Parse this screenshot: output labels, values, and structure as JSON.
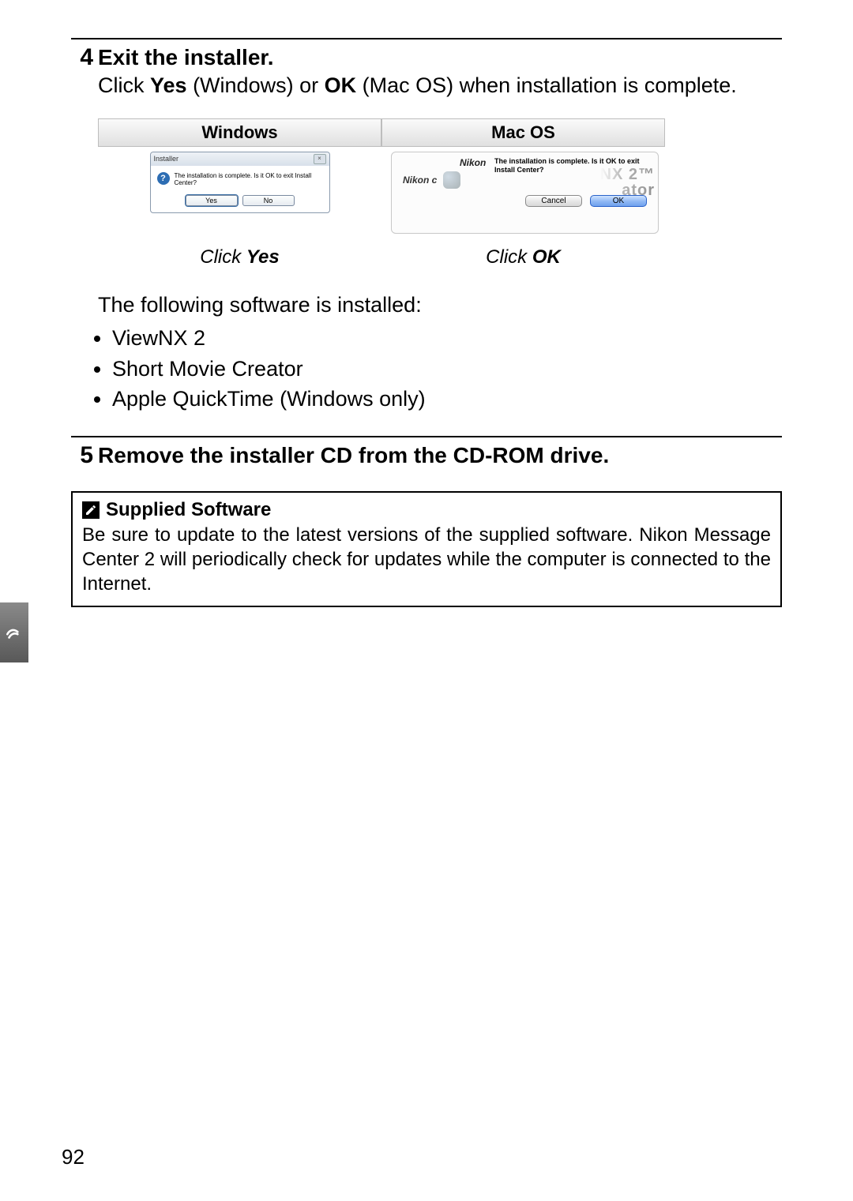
{
  "step4": {
    "number": "4",
    "title": "Exit the installer.",
    "desc_prefix": "Click ",
    "desc_yes": "Yes",
    "desc_mid1": " (Windows) or ",
    "desc_ok": "OK",
    "desc_mid2": " (Mac OS) when installation is com",
    "desc_suffix": "plete."
  },
  "os_headers": {
    "windows": "Windows",
    "mac": "Mac OS"
  },
  "win_dialog": {
    "title": "Installer",
    "close": "×",
    "q": "?",
    "msg": "The installation is complete. Is it OK to exit Install Center?",
    "yes": "Yes",
    "no": "No"
  },
  "mac_dialog": {
    "brand_small": "Nikon c",
    "brand_top": "Nikon",
    "msg": "The installation is complete. Is it OK to exit Install Center?",
    "cancel": "Cancel",
    "ok": "OK",
    "ghost1": "NX 2™",
    "ghost2": "ator"
  },
  "captions": {
    "win_click": "Click ",
    "win_click_bold": "Yes",
    "mac_click": "Click ",
    "mac_click_bold": "OK"
  },
  "installed": {
    "lead": "The following software is installed:",
    "items": [
      "ViewNX 2",
      "Short Movie Creator",
      "Apple QuickTime (Windows only)"
    ]
  },
  "step5": {
    "number": "5",
    "title": "Remove the installer CD from the CD-ROM drive."
  },
  "note": {
    "title": "Supplied Software",
    "body": "Be sure to update to the latest versions of the supplied software. Nikon Message Center 2 will periodically check for updates while the computer is connected to the Internet."
  },
  "page_number": "92"
}
